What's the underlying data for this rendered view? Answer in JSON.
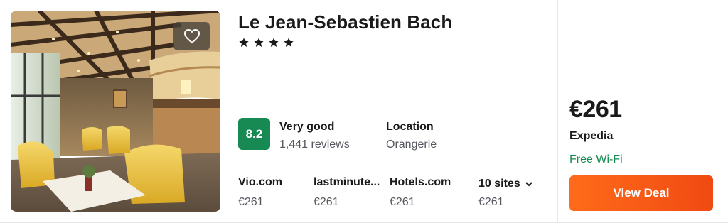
{
  "hotel": {
    "name": "Le Jean-Sebastien Bach",
    "star_count": 4,
    "rating_score": "8.2",
    "rating_label": "Very good",
    "review_count": "1,441 reviews",
    "location_label": "Location",
    "location_value": "Orangerie",
    "photo_icon": "hotel-lobby-photo",
    "favorite_icon": "heart-outline-icon"
  },
  "providers": [
    {
      "name": "Vio.com",
      "price": "€261"
    },
    {
      "name": "lastminute...",
      "price": "€261"
    },
    {
      "name": "Hotels.com",
      "price": "€261"
    },
    {
      "name": "10 sites",
      "price": "€261",
      "icon": "chevron-down-icon"
    }
  ],
  "deal": {
    "price": "€261",
    "provider": "Expedia",
    "amenity": "Free Wi-Fi",
    "button_label": "View Deal"
  },
  "colors": {
    "rating_badge": "#168a52",
    "amenity_text": "#168a52",
    "cta_start": "#ff6b1a",
    "cta_end": "#f04a12"
  }
}
